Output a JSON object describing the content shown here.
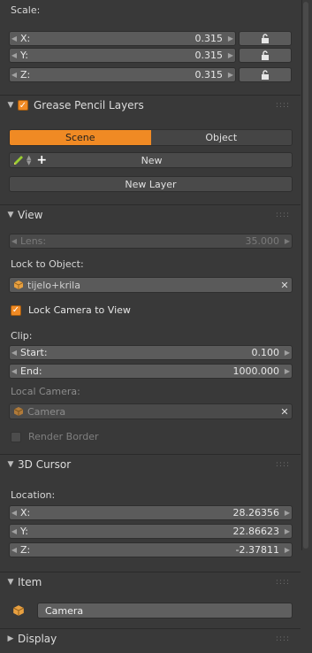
{
  "transform": {
    "scale_label": "Scale:",
    "scale": [
      {
        "axis": "X:",
        "value": "0.315"
      },
      {
        "axis": "Y:",
        "value": "0.315"
      },
      {
        "axis": "Z:",
        "value": "0.315"
      }
    ]
  },
  "grease_pencil": {
    "title": "Grease Pencil Layers",
    "tabs": [
      "Scene",
      "Object"
    ],
    "new_label": "New",
    "new_layer_label": "New Layer"
  },
  "view": {
    "title": "View",
    "lens_label": "Lens:",
    "lens_value": "35.000",
    "lock_to_object_label": "Lock to Object:",
    "lock_object_value": "tijelo+krila",
    "lock_camera_label": "Lock Camera to View",
    "clip_label": "Clip:",
    "clip_start_label": "Start:",
    "clip_start_value": "0.100",
    "clip_end_label": "End:",
    "clip_end_value": "1000.000",
    "local_camera_label": "Local Camera:",
    "local_camera_value": "Camera",
    "render_border_label": "Render Border"
  },
  "cursor": {
    "title": "3D Cursor",
    "location_label": "Location:",
    "location": [
      {
        "axis": "X:",
        "value": "28.26356"
      },
      {
        "axis": "Y:",
        "value": "22.86623"
      },
      {
        "axis": "Z:",
        "value": "-2.37811"
      }
    ]
  },
  "item": {
    "title": "Item",
    "name_value": "Camera"
  },
  "display": {
    "title": "Display"
  },
  "colors": {
    "accent": "#f08a24",
    "panel_bg": "#393939"
  }
}
